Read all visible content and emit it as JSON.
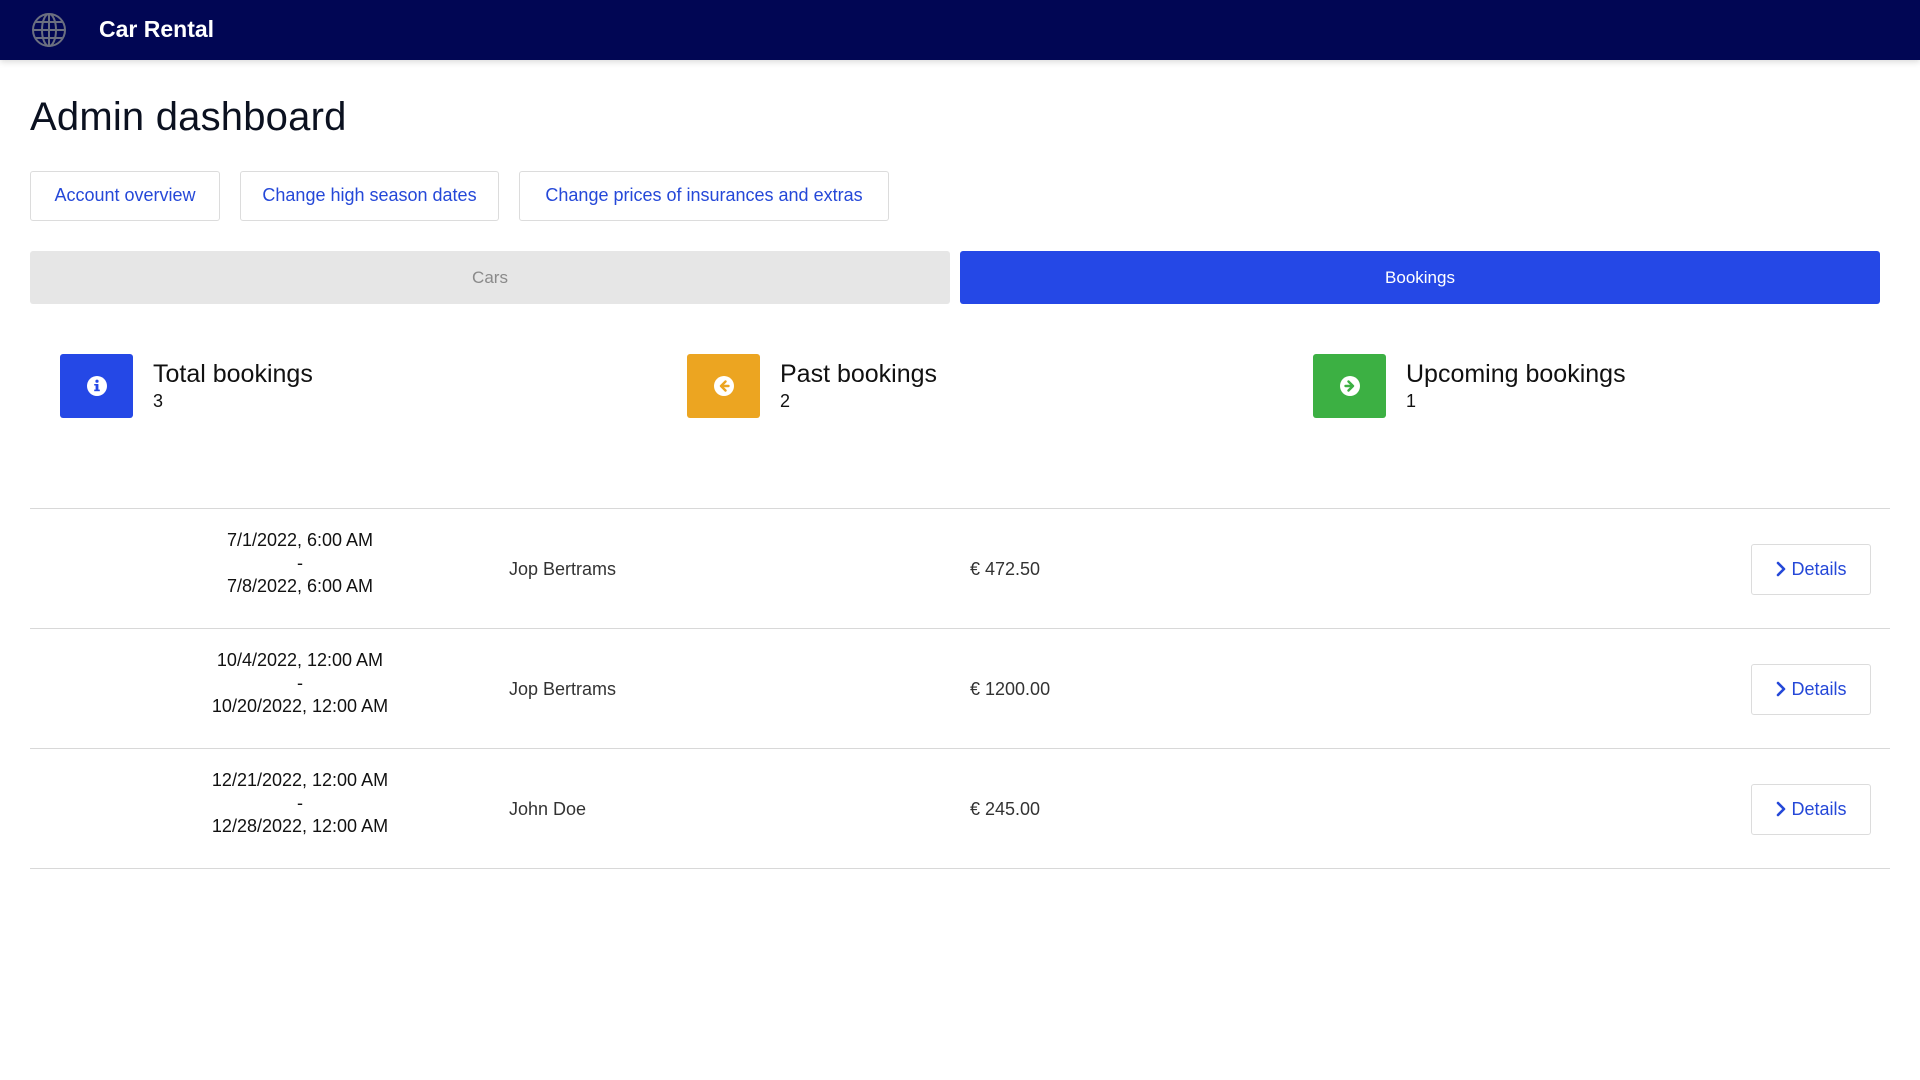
{
  "app": {
    "title": "Car Rental"
  },
  "page": {
    "title": "Admin dashboard"
  },
  "actions": [
    {
      "label": "Account overview"
    },
    {
      "label": "Change high season dates"
    },
    {
      "label": "Change prices of insurances and extras"
    }
  ],
  "tabs": [
    {
      "label": "Cars",
      "active": false
    },
    {
      "label": "Bookings",
      "active": true
    }
  ],
  "stats": [
    {
      "title": "Total bookings",
      "value": "3",
      "icon": "info-icon",
      "color": "#2548e6"
    },
    {
      "title": "Past bookings",
      "value": "2",
      "icon": "arrow-left-circle-icon",
      "color": "#eca521"
    },
    {
      "title": "Upcoming bookings",
      "value": "1",
      "icon": "arrow-right-circle-icon",
      "color": "#3cb043"
    }
  ],
  "bookings": [
    {
      "start": "7/1/2022, 6:00 AM",
      "separator": "-",
      "end": "7/8/2022, 6:00 AM",
      "customer": "Jop Bertrams",
      "price": "€ 472.50",
      "details_label": "Details"
    },
    {
      "start": "10/4/2022, 12:00 AM",
      "separator": "-",
      "end": "10/20/2022, 12:00 AM",
      "customer": "Jop Bertrams",
      "price": "€ 1200.00",
      "details_label": "Details"
    },
    {
      "start": "12/21/2022, 12:00 AM",
      "separator": "-",
      "end": "12/28/2022, 12:00 AM",
      "customer": "John Doe",
      "price": "€ 245.00",
      "details_label": "Details"
    }
  ],
  "colors": {
    "navbar": "#010654",
    "primary": "#2548e6",
    "link": "#2548d8",
    "inactive_tab": "#e6e6e6"
  }
}
